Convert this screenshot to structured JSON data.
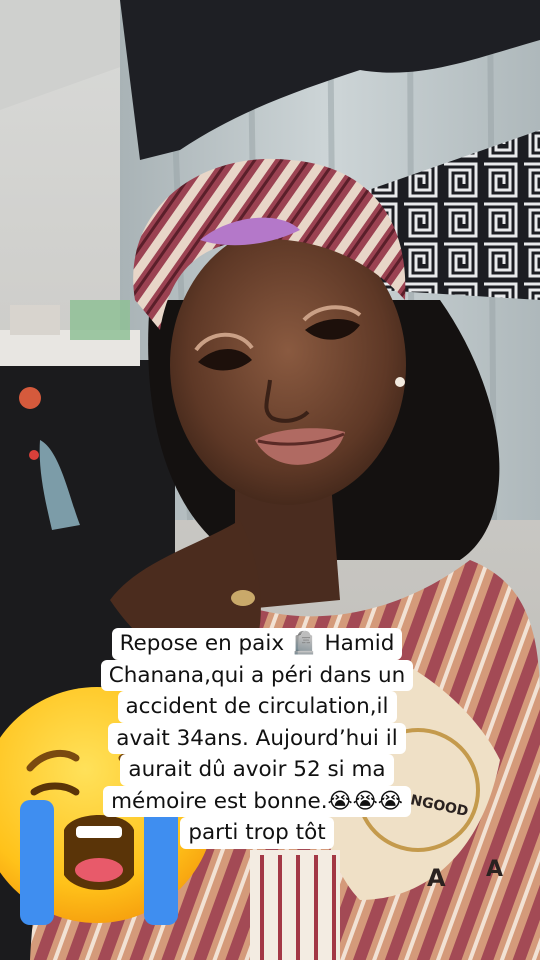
{
  "caption": {
    "lines": [
      "Repose en paix 🪦 Hamid",
      "Chanana,qui a péri dans un",
      "accident de circulation,il",
      "avait 34ans. Aujourd’hui il",
      "aurait dû avoir 52 si ma",
      "mémoire est bonne.😭😭😭",
      "parti trop tôt"
    ]
  },
  "sticker": {
    "icon": "loudly-crying-face-icon"
  },
  "fabric_letters": [
    "A",
    "A",
    "ANGOOD"
  ],
  "colors": {
    "caption_bg": "#ffffff",
    "caption_text": "#111111",
    "curtain": "#b9c3c6",
    "curtain_pattern": "#1c1d22",
    "headwrap": "#8e3a45",
    "outfit": "#c98a6a"
  }
}
